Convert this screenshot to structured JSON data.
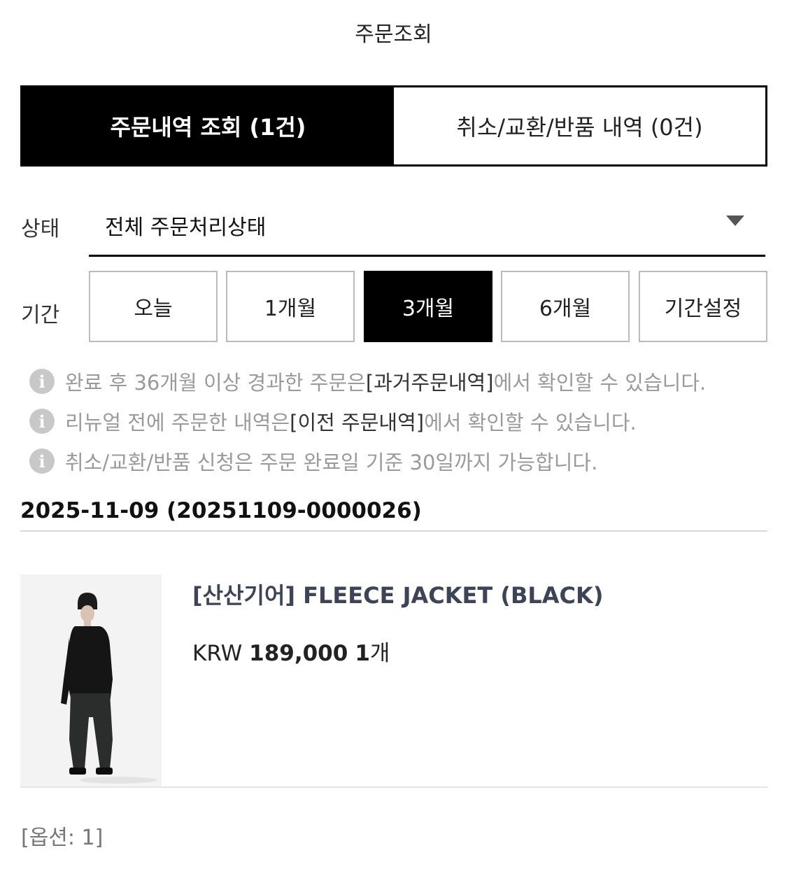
{
  "header": {
    "title": "주문조회"
  },
  "tabs": [
    {
      "label": "주문내역 조회 (1건)",
      "active": true
    },
    {
      "label": "취소/교환/반품 내역 (0건)",
      "active": false
    }
  ],
  "filters": {
    "status_label": "상태",
    "status_value": "전체 주문처리상태",
    "period_label": "기간",
    "period_options": [
      "오늘",
      "1개월",
      "3개월",
      "6개월",
      "기간설정"
    ],
    "period_selected": "3개월"
  },
  "notices": [
    {
      "before": "완료 후 36개월 이상 경과한 주문은 ",
      "link": "[과거주문내역]",
      "after": "에서 확인할 수 있습니다."
    },
    {
      "before": "리뉴얼 전에 주문한 내역은 ",
      "link": "[이전 주문내역]",
      "after": "에서 확인할 수 있습니다."
    },
    {
      "before": "취소/교환/반품 신청은 주문 완료일 기준 30일까지 가능합니다.",
      "link": "",
      "after": ""
    }
  ],
  "order": {
    "header": "2025-11-09 (20251109-0000026)",
    "item": {
      "name": "[산산기어] FLEECE JACKET (BLACK)",
      "currency": "KRW",
      "price": "189,000",
      "qty_num": "1",
      "qty_unit": "개"
    },
    "option": "[옵션: 1]"
  },
  "icons": {
    "info": "info-icon",
    "dropdown": "caret-down-icon"
  },
  "colors": {
    "active_bg": "#000000",
    "product_name": "#3d4457",
    "notice_text": "#9a9a9a"
  }
}
